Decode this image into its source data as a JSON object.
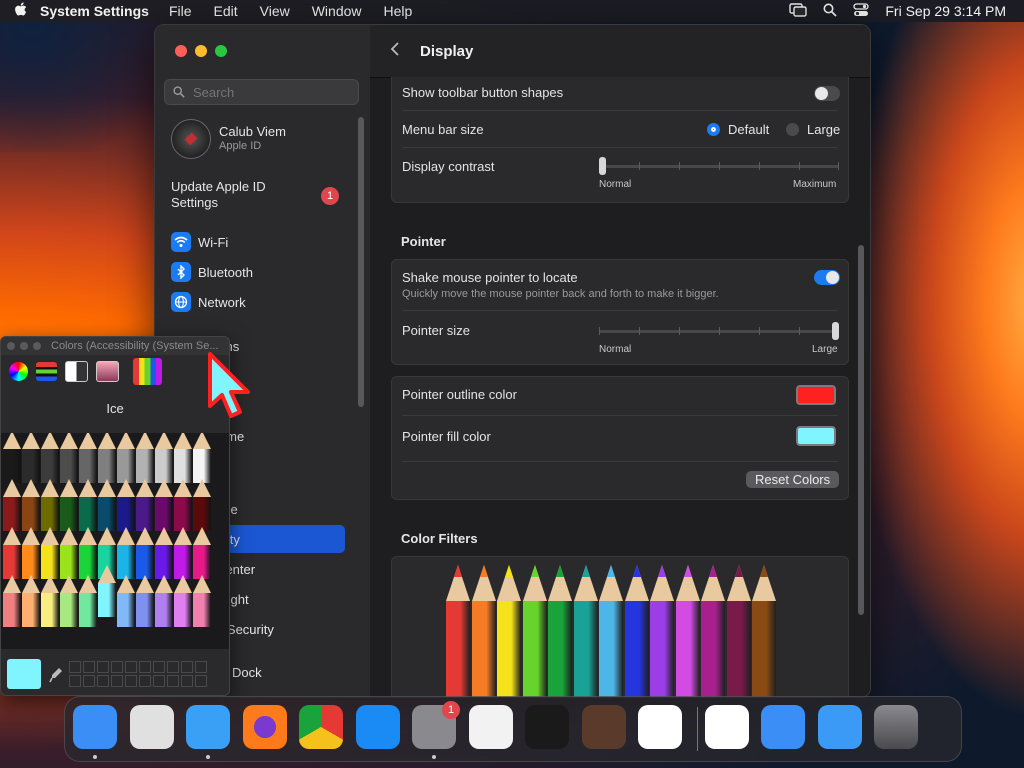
{
  "menubar": {
    "app_name": "System Settings",
    "menus": [
      "File",
      "Edit",
      "View",
      "Window",
      "Help"
    ],
    "datetime": "Fri Sep 29  3:14 PM"
  },
  "sidebar": {
    "search_placeholder": "Search",
    "profile": {
      "name": "Calub Viem",
      "sub": "Apple ID"
    },
    "update": {
      "label": "Update Apple ID Settings",
      "badge": "1"
    },
    "items": [
      {
        "label": "Wi-Fi",
        "color": "#1a7bf2"
      },
      {
        "label": "Bluetooth",
        "color": "#1a7bf2"
      },
      {
        "label": "Network",
        "color": "#1a7bf2"
      },
      {
        "label": "cations"
      },
      {
        "label": "en Time"
      },
      {
        "label": "ral"
      },
      {
        "label": "arance"
      },
      {
        "label": "ssibility"
      },
      {
        "label": "rol Center"
      },
      {
        "label": "Spotlight"
      },
      {
        "label": "cy & Security"
      },
      {
        "label": "top & Dock"
      }
    ]
  },
  "main": {
    "title": "Display",
    "display": {
      "toolbar_shapes": {
        "label": "Show toolbar button shapes",
        "on": false
      },
      "menu_bar_size": {
        "label": "Menu bar size",
        "options": [
          "Default",
          "Large"
        ],
        "selected": "Default"
      },
      "contrast": {
        "label": "Display contrast",
        "min": "Normal",
        "max": "Maximum",
        "value": 0
      }
    },
    "pointer": {
      "section": "Pointer",
      "shake": {
        "label": "Shake mouse pointer to locate",
        "desc": "Quickly move the mouse pointer back and forth to make it bigger.",
        "on": true
      },
      "size": {
        "label": "Pointer size",
        "min": "Normal",
        "max": "Large",
        "value": 1
      },
      "outline": {
        "label": "Pointer outline color",
        "color": "#ff2020"
      },
      "fill": {
        "label": "Pointer fill color",
        "color": "#80f4ff"
      },
      "reset": "Reset Colors"
    },
    "filters": {
      "section": "Color Filters",
      "pencils": [
        "#e53935",
        "#f57c24",
        "#f4e21a",
        "#66d42a",
        "#1aa33a",
        "#18a396",
        "#4cb6e8",
        "#2535e0",
        "#9b3ee6",
        "#d24be2",
        "#a8208e",
        "#7a1a4a",
        "#8a4a14"
      ]
    }
  },
  "colors_panel": {
    "title": "Colors (Accessibility (System Se...",
    "selected_name": "Ice",
    "selected_color": "#80f4ff",
    "rows": [
      [
        "#1a1a1a",
        "#2b2b2b",
        "#3c3c3c",
        "#4d4d4d",
        "#666666",
        "#7f7f7f",
        "#999999",
        "#b2b2b2",
        "#cccccc",
        "#e0e0e0",
        "#f5f5f5"
      ],
      [
        "#8b1a1a",
        "#8b4513",
        "#6b6b00",
        "#1a5a1a",
        "#0a6b4a",
        "#0a4a6b",
        "#1a1a8b",
        "#4a1a8b",
        "#6b0a6b",
        "#8b0a4a",
        "#5a0a0a"
      ],
      [
        "#e53935",
        "#ff8c1a",
        "#f4e21a",
        "#9ae21a",
        "#1ad43a",
        "#1ad4a0",
        "#1ab4e8",
        "#1a5ae8",
        "#6a1ae8",
        "#c01ae8",
        "#e81a8a"
      ],
      [
        "#f08080",
        "#ffb070",
        "#f8ee80",
        "#a8e880",
        "#70e8a0",
        "#80f4ff",
        "#80b8f8",
        "#8090f0",
        "#b080f0",
        "#e080f0",
        "#f080b0"
      ]
    ]
  },
  "dock": {
    "apps": [
      {
        "name": "Finder",
        "color": "#3a8ef5"
      },
      {
        "name": "Launchpad",
        "color": "#e0e0e0"
      },
      {
        "name": "Safari",
        "color": "#3aa0f5"
      },
      {
        "name": "Firefox",
        "color": "#ff7a1a"
      },
      {
        "name": "Chrome",
        "color": "#f0f0f0"
      },
      {
        "name": "App Store",
        "color": "#1a8af5"
      },
      {
        "name": "System Settings",
        "color": "#8a8a8e",
        "badge": "1"
      },
      {
        "name": "TextEdit",
        "color": "#f2f2f2"
      },
      {
        "name": "Terminal",
        "color": "#1a1a1a"
      },
      {
        "name": "GarageBand",
        "color": "#5a3a2a"
      },
      {
        "name": "VS Code",
        "color": "#ffffff"
      },
      {
        "name": "Visual Studio",
        "color": "#ffffff"
      },
      {
        "name": "Weather",
        "color": "#3a8ef5"
      },
      {
        "name": "Mail",
        "color": "#3a9af5"
      },
      {
        "name": "Trash",
        "color": "#6a6a6e"
      }
    ]
  }
}
